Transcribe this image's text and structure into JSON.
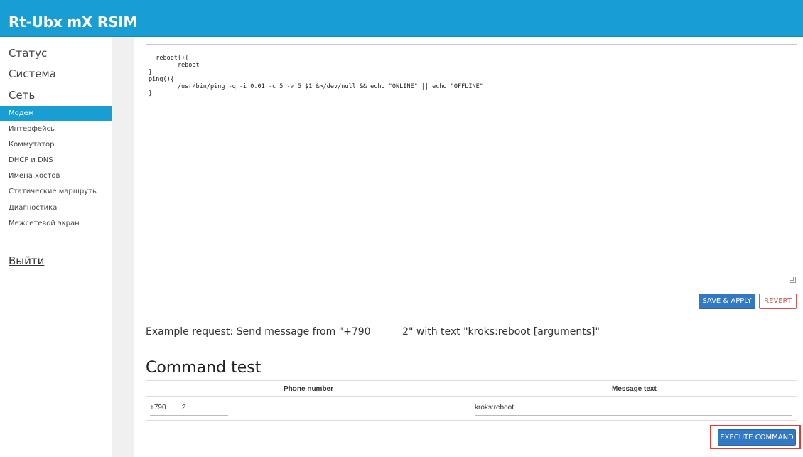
{
  "header": {
    "brand": "Rt-Ubx mX RSIM",
    "color": "#199ed4"
  },
  "sidebar": {
    "top_items": [
      "Статус",
      "Система",
      "Сеть"
    ],
    "sub_items": [
      {
        "label": "Модем",
        "active": true
      },
      {
        "label": "Интерфейсы"
      },
      {
        "label": "Коммутатор"
      },
      {
        "label": "DHCP и DNS"
      },
      {
        "label": "Имена хостов"
      },
      {
        "label": "Статические маршруты"
      },
      {
        "label": "Диагностика"
      },
      {
        "label": "Межсетевой экран"
      }
    ],
    "logout": "Выйти"
  },
  "editor": {
    "content": "reboot(){\n        reboot\n}\nping(){\n        /usr/bin/ping -q -i 0.01 -c 5 -w 5 $1 &>/dev/null && echo \"ONLINE\" || echo \"OFFLINE\"\n}"
  },
  "actions": {
    "save_label": "SAVE & APPLY",
    "revert_label": "REVERT"
  },
  "example_text": "Example request: Send message from \"+790          2\" with text \"kroks:reboot [arguments]\"",
  "command_test": {
    "title": "Command test",
    "columns": {
      "phone": "Phone number",
      "message": "Message text"
    },
    "phone_value": "+790        2",
    "message_value": "kroks:reboot",
    "execute_label": "EXECUTE COMMAND"
  },
  "colors": {
    "accent": "#199ed4",
    "button": "#3278c2",
    "danger": "#d9534f",
    "highlight": "#e53935"
  }
}
